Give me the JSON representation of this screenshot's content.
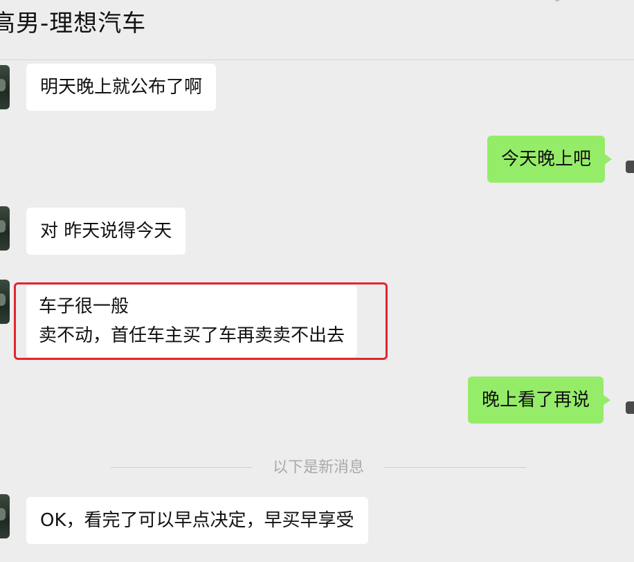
{
  "header": {
    "title": "高男-理想汽车"
  },
  "messages": [
    {
      "side": "in",
      "text": "明天晚上就公布了啊"
    },
    {
      "side": "out",
      "text": "今天晚上吧"
    },
    {
      "side": "in",
      "text": "对  昨天说得今天"
    },
    {
      "side": "in",
      "lines": [
        "车子很一般",
        "卖不动，首任车主买了车再卖卖不出去"
      ],
      "highlighted": true
    },
    {
      "side": "out",
      "text": "晚上看了再说"
    },
    {
      "side": "in",
      "text": "OK，看完了可以早点决定，早买早享受"
    }
  ],
  "divider": {
    "text": "以下是新消息"
  },
  "colors": {
    "background": "#ededed",
    "incoming_bubble": "#ffffff",
    "outgoing_bubble": "#95ec69",
    "highlight_border": "#e0262f"
  }
}
